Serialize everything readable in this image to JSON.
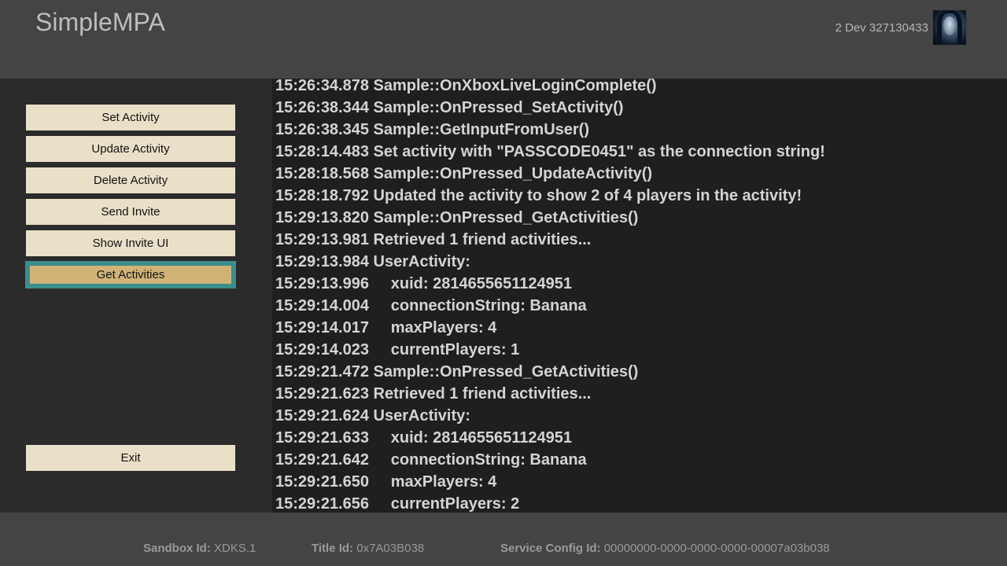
{
  "header": {
    "title": "SimpleMPA",
    "gamertag": "2 Dev 327130433"
  },
  "menu": {
    "items": [
      {
        "label": "Set Activity",
        "selected": false
      },
      {
        "label": "Update Activity",
        "selected": false
      },
      {
        "label": "Delete Activity",
        "selected": false
      },
      {
        "label": "Send Invite",
        "selected": false
      },
      {
        "label": "Show Invite UI",
        "selected": false
      },
      {
        "label": "Get Activities",
        "selected": true
      }
    ],
    "exit_label": "Exit"
  },
  "log": {
    "lines": [
      "15:26:34.878 Sample::OnXboxLiveLoginComplete()",
      "15:26:38.344 Sample::OnPressed_SetActivity()",
      "15:26:38.345 Sample::GetInputFromUser()",
      "15:28:14.483 Set activity with \"PASSCODE0451\" as the connection string!",
      "15:28:18.568 Sample::OnPressed_UpdateActivity()",
      "15:28:18.792 Updated the activity to show 2 of 4 players in the activity!",
      "15:29:13.820 Sample::OnPressed_GetActivities()",
      "15:29:13.981 Retrieved 1 friend activities...",
      "15:29:13.984 UserActivity:",
      "15:29:13.996     xuid: 2814655651124951",
      "15:29:14.004     connectionString: Banana",
      "15:29:14.017     maxPlayers: 4",
      "15:29:14.023     currentPlayers: 1",
      "15:29:21.472 Sample::OnPressed_GetActivities()",
      "15:29:21.623 Retrieved 1 friend activities...",
      "15:29:21.624 UserActivity:",
      "15:29:21.633     xuid: 2814655651124951",
      "15:29:21.642     connectionString: Banana",
      "15:29:21.650     maxPlayers: 4",
      "15:29:21.656     currentPlayers: 2"
    ]
  },
  "footer": {
    "sandbox_label": "Sandbox Id:",
    "sandbox_value": "XDKS.1",
    "title_label": "Title Id:",
    "title_value": "0x7A03B038",
    "scid_label": "Service Config Id:",
    "scid_value": "00000000-0000-0000-0000-00007a03b038"
  },
  "colors": {
    "button_bg": "#eae0c8",
    "button_selected_bg": "#d1b378",
    "selection_border": "#3a8e8c"
  }
}
